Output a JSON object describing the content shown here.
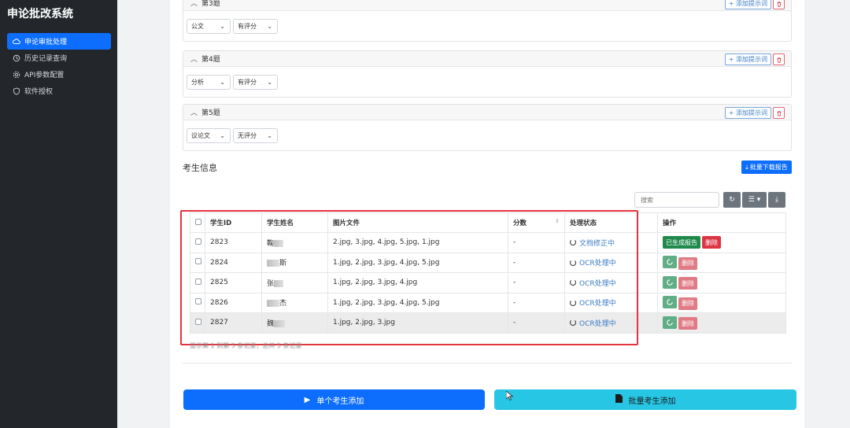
{
  "app": {
    "title": "申论批改系统"
  },
  "sidebar": {
    "items": [
      {
        "label": "申论审批处理",
        "icon": "cloud-icon",
        "active": true
      },
      {
        "label": "历史记录查询",
        "icon": "clock-icon",
        "active": false
      },
      {
        "label": "API参数配置",
        "icon": "gear-icon",
        "active": false
      },
      {
        "label": "软件授权",
        "icon": "shield-icon",
        "active": false
      }
    ]
  },
  "questions": [
    {
      "title": "第3题",
      "type": "公文",
      "scoring": "有评分",
      "add_hint_label": "+ 添加提示词"
    },
    {
      "title": "第4题",
      "type": "分析",
      "scoring": "有评分",
      "add_hint_label": "+ 添加提示词"
    },
    {
      "title": "第5题",
      "type": "议论文",
      "scoring": "无评分",
      "add_hint_label": "+ 添加提示词"
    }
  ],
  "students_section": {
    "title": "考生信息",
    "batch_download_label": "批量下载报告",
    "search_placeholder": "搜索",
    "columns": [
      "学生ID",
      "学生姓名",
      "图片文件",
      "分数",
      "处理状态",
      "操作"
    ],
    "rows": [
      {
        "id": "2823",
        "name": "鞠",
        "files": "2.jpg, 3.jpg, 4.jpg, 5.jpg, 1.jpg",
        "score": "-",
        "status": "文档修正中",
        "actions": [
          "已生成报告",
          "删除"
        ]
      },
      {
        "id": "2824",
        "name": "斯",
        "files": "1.jpg, 2.jpg, 3.jpg, 4.jpg, 5.jpg",
        "score": "-",
        "status": "OCR处理中",
        "actions": [
          "删除"
        ]
      },
      {
        "id": "2825",
        "name": "张",
        "files": "1.jpg, 2.jpg, 3.jpg, 4.jpg",
        "score": "-",
        "status": "OCR处理中",
        "actions": [
          "删除"
        ]
      },
      {
        "id": "2826",
        "name": "杰",
        "files": "1.jpg, 2.jpg, 3.jpg, 4.jpg, 5.jpg",
        "score": "-",
        "status": "OCR处理中",
        "actions": [
          "删除"
        ]
      },
      {
        "id": "2827",
        "name": "魏",
        "files": "1.jpg, 2.jpg, 3.jpg",
        "score": "-",
        "status": "OCR处理中",
        "actions": [
          "删除"
        ]
      }
    ],
    "footer": "显示第 1 到第 5 条记录，总共 5 条记录"
  },
  "bottom_buttons": {
    "single_add": "单个考生添加",
    "batch_add": "批量考生添加"
  },
  "colors": {
    "primary": "#0d6efd",
    "info": "#27c6e5",
    "danger": "#dc3545",
    "success": "#1f8a4c",
    "sidebar_bg": "#23272b"
  }
}
